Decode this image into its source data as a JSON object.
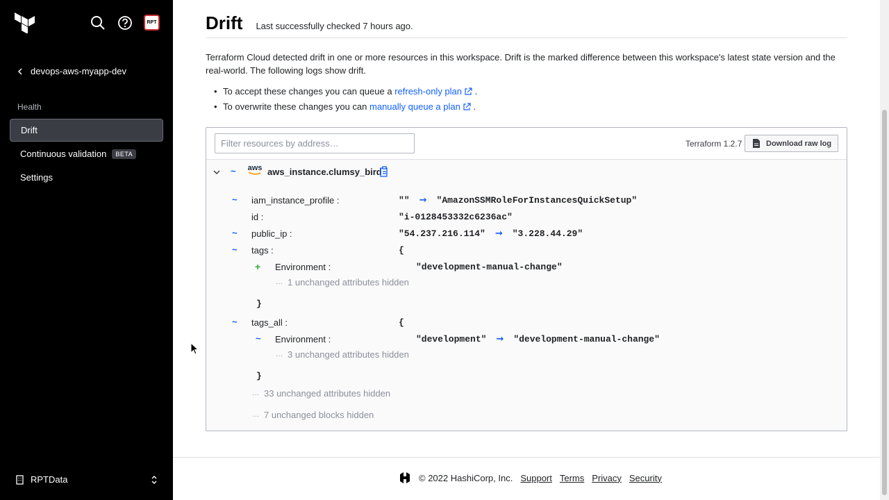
{
  "sidebar": {
    "back_label": "devops-aws-myapp-dev",
    "section_label": "Health",
    "items": [
      {
        "label": "Drift",
        "active": true
      },
      {
        "label": "Continuous validation",
        "badge": "BETA"
      },
      {
        "label": "Settings"
      }
    ],
    "org_name": "RPTData",
    "avatar_text": "RPT"
  },
  "header": {
    "title": "Drift",
    "last_checked": "Last successfully checked 7 hours ago."
  },
  "description": "Terraform Cloud detected drift in one or more resources in this workspace. Drift is the marked difference between this workspace's latest state version and the real-world. The following logs show drift.",
  "bullets": [
    {
      "prefix": "To accept these changes you can queue a ",
      "link": "refresh-only plan",
      "suffix": "."
    },
    {
      "prefix": "To overwrite these changes you can ",
      "link": "manually queue a plan",
      "suffix": "."
    }
  ],
  "panel": {
    "filter_placeholder": "Filter resources by address…",
    "tf_version": "Terraform 1.2.7",
    "download_label": "Download raw log",
    "provider_label": "aws",
    "resource_name": "aws_instance.clumsy_bird",
    "attrs": {
      "iam": {
        "key": "iam_instance_profile :",
        "old": "\"\"",
        "new": "\"AmazonSSMRoleForInstancesQuickSetup\""
      },
      "id": {
        "key": "id :",
        "value": "\"i-0128453332c6236ac\""
      },
      "public_ip": {
        "key": "public_ip :",
        "old": "\"54.237.216.114\"",
        "new": "\"3.228.44.29\""
      },
      "tags": {
        "key": "tags :",
        "open": "{",
        "env_key": "Environment :",
        "env_value": "\"development-manual-change\"",
        "hidden": "1 unchanged attributes hidden",
        "close": "}"
      },
      "tags_all": {
        "key": "tags_all :",
        "open": "{",
        "env_key": "Environment :",
        "env_old": "\"development\"",
        "env_new": "\"development-manual-change\"",
        "hidden": "3 unchanged attributes hidden",
        "close": "}"
      }
    },
    "hidden_attrs": "33 unchanged attributes hidden",
    "hidden_blocks": "7 unchanged blocks hidden",
    "change_symbol": "~",
    "add_symbol": "+",
    "arrow_symbol": "→",
    "ellipsis": "···"
  },
  "footer": {
    "copyright": "© 2022 HashiCorp, Inc.",
    "links": [
      "Support",
      "Terms",
      "Privacy",
      "Security"
    ]
  },
  "colors": {
    "sidebar_bg": "#000000",
    "link": "#1060ff",
    "add": "#2eb039"
  }
}
